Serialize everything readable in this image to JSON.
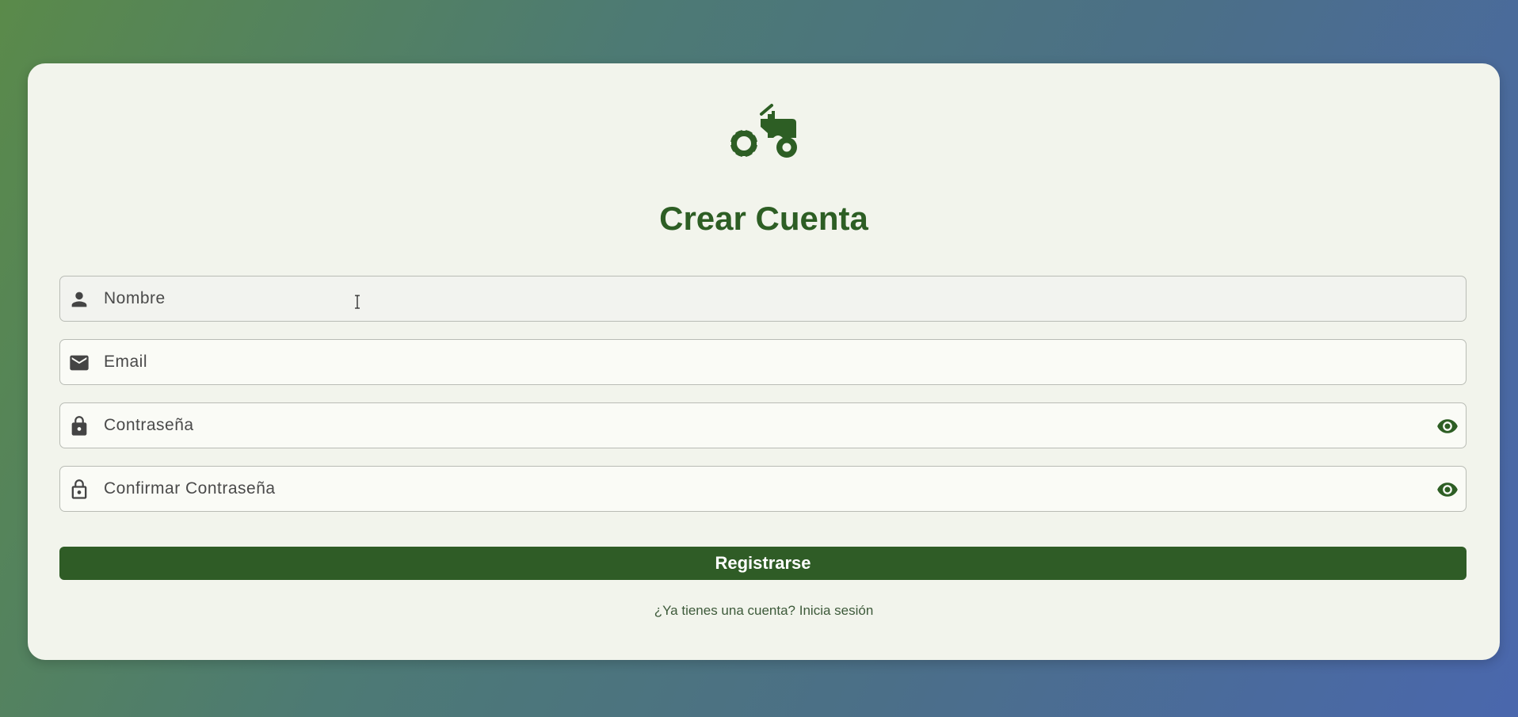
{
  "page": {
    "title": "Crear Cuenta",
    "logo_icon": "tractor-icon",
    "accent_color": "#2d5e24"
  },
  "form": {
    "fields": [
      {
        "name": "nombre",
        "icon": "person-icon",
        "placeholder": "Nombre",
        "value": ""
      },
      {
        "name": "email",
        "icon": "mail-icon",
        "placeholder": "Email",
        "value": ""
      },
      {
        "name": "password",
        "icon": "lock-icon",
        "placeholder": "Contraseña",
        "value": "",
        "toggle_icon": "eye-icon"
      },
      {
        "name": "confirm_password",
        "icon": "lock-open-icon",
        "placeholder": "Confirmar Contraseña",
        "value": "",
        "toggle_icon": "eye-icon"
      }
    ],
    "submit_label": "Registrarse",
    "login_prompt": "¿Ya tienes una cuenta? Inicia sesión"
  }
}
